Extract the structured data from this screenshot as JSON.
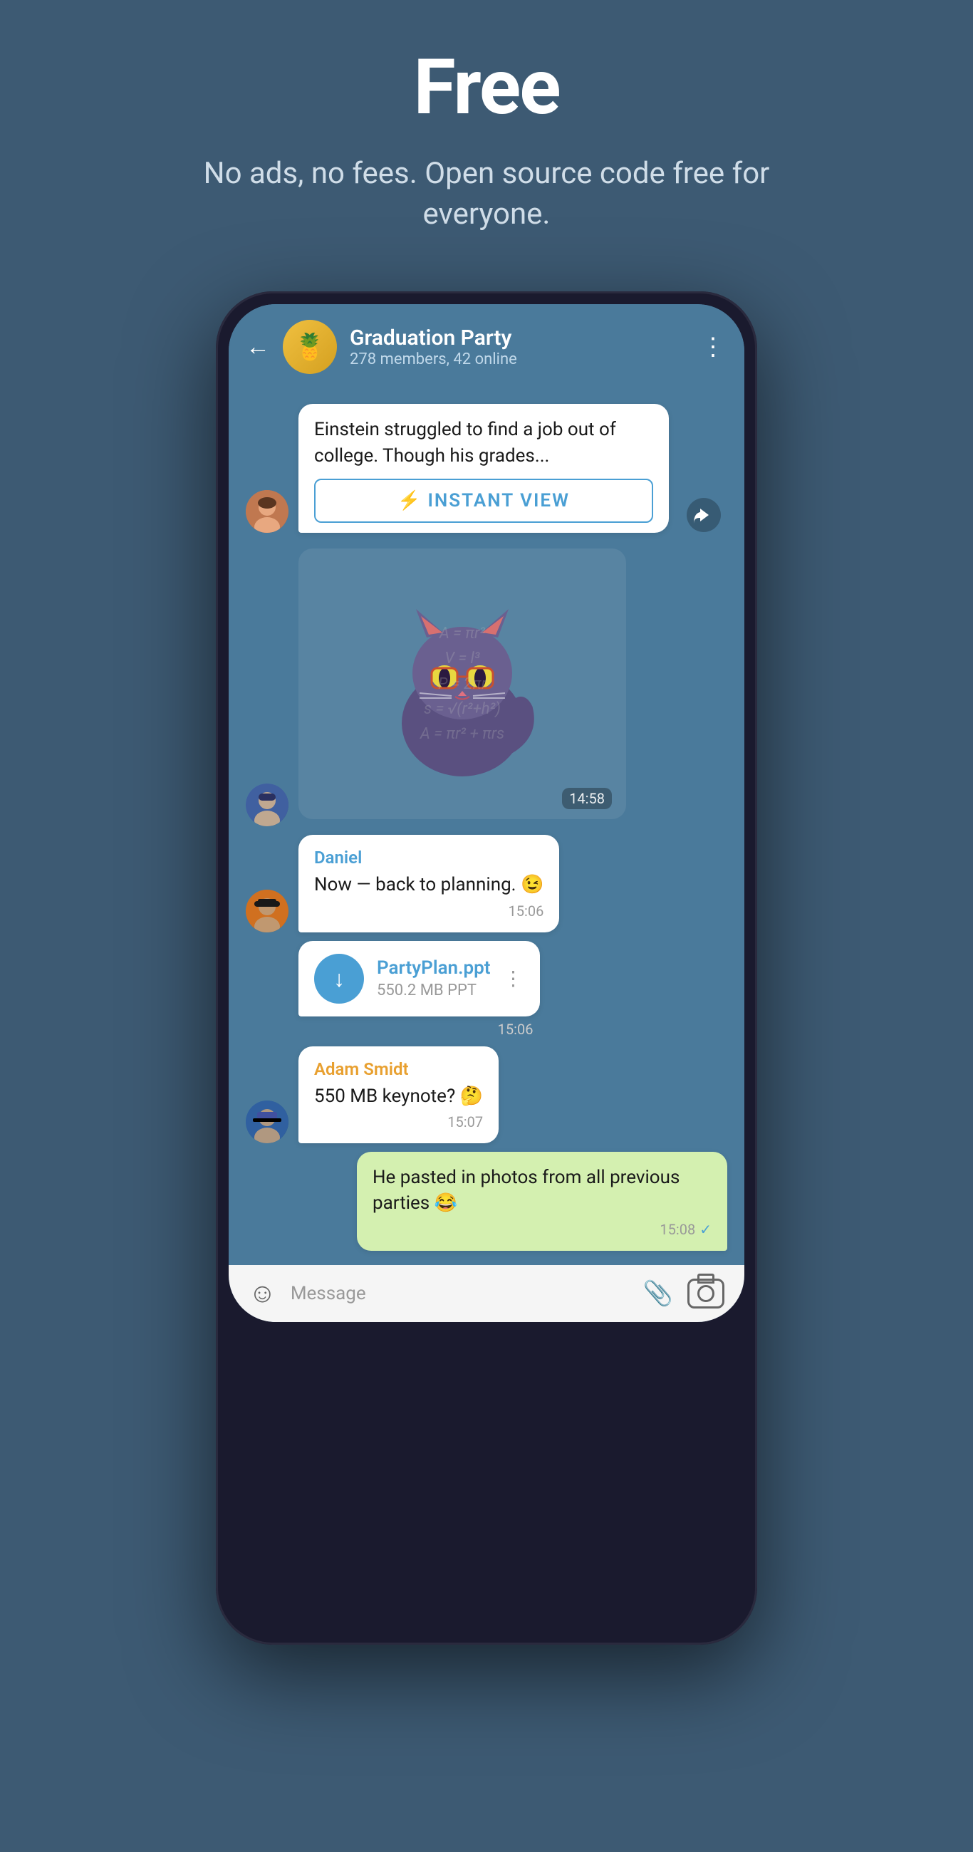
{
  "hero": {
    "title": "Free",
    "subtitle": "No ads, no fees. Open source code free for everyone."
  },
  "chat": {
    "header": {
      "back_label": "←",
      "group_name": "Graduation Party",
      "group_meta": "278 members, 42 online",
      "more_icon": "⋮"
    },
    "messages": [
      {
        "id": "article-msg",
        "type": "article",
        "text": "Einstein struggled to find a job out of college. Though his grades...",
        "instant_view_label": "INSTANT VIEW",
        "avatar": "girl"
      },
      {
        "id": "sticker-msg",
        "type": "sticker",
        "time": "14:58",
        "avatar": "boy1"
      },
      {
        "id": "daniel-msg",
        "type": "text",
        "sender": "Daniel",
        "sender_color": "blue",
        "text": "Now — back to planning. 😉",
        "time": "15:06",
        "avatar": "boy2"
      },
      {
        "id": "file-msg",
        "type": "file",
        "file_name": "PartyPlan.ppt",
        "file_size": "550.2 MB PPT",
        "time": "15:06",
        "avatar": "boy2"
      },
      {
        "id": "adam-msg",
        "type": "text",
        "sender": "Adam Smidt",
        "sender_color": "orange",
        "text": "550 MB keynote? 🤔",
        "time": "15:07",
        "avatar": "boy3"
      },
      {
        "id": "sent-msg",
        "type": "sent",
        "text": "He pasted in photos from all previous parties 😂",
        "time": "15:08",
        "checkmark": "✓"
      }
    ],
    "input": {
      "placeholder": "Message",
      "emoji_icon": "☺",
      "attach_icon": "📎"
    }
  }
}
